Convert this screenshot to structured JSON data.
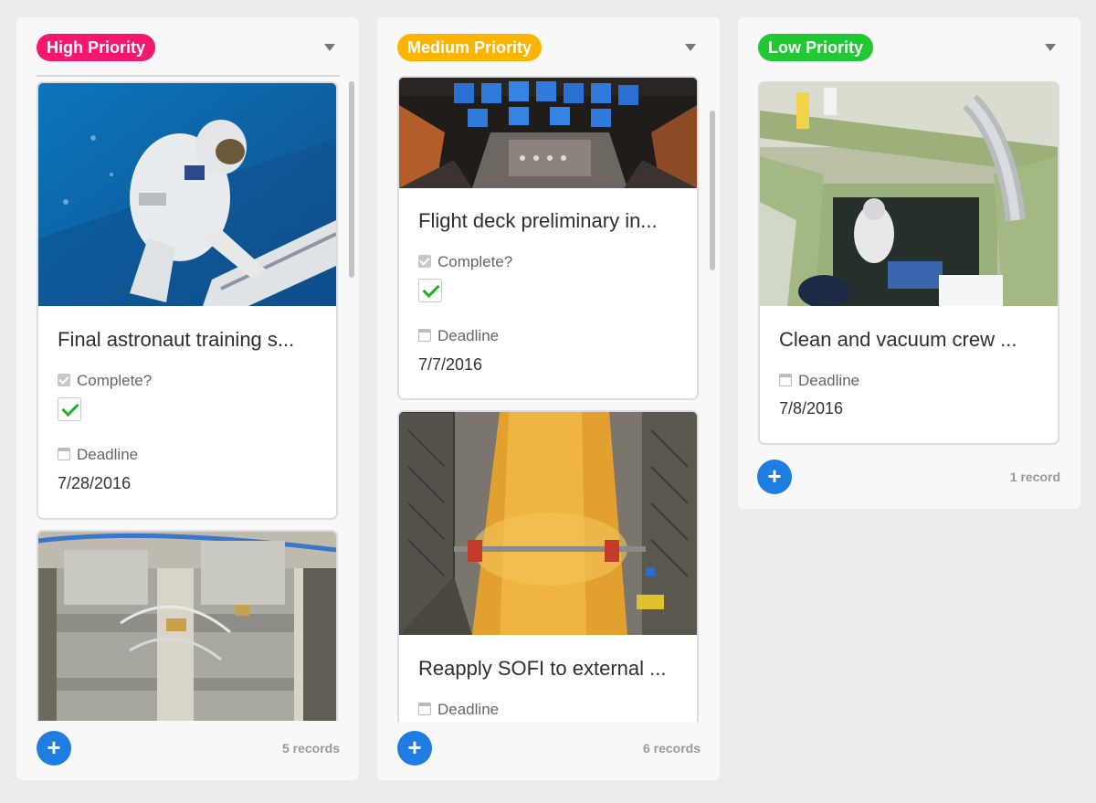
{
  "stacks": [
    {
      "name": "High Priority",
      "color": "#f7186d",
      "record_count": "5 records",
      "cards": [
        {
          "title": "Final astronaut training s...",
          "image": "astronaut-underwater-training-photo",
          "complete_label": "Complete?",
          "complete": true,
          "deadline_label": "Deadline",
          "deadline": "7/28/2016"
        },
        {
          "image": "space-station-hardware-photo"
        }
      ]
    },
    {
      "name": "Medium Priority",
      "color": "#fcb400",
      "record_count": "6 records",
      "cards": [
        {
          "title": "Flight deck preliminary in...",
          "image": "shuttle-flight-deck-photo",
          "complete_label": "Complete?",
          "complete": true,
          "deadline_label": "Deadline",
          "deadline": "7/7/2016"
        },
        {
          "title": "Reapply SOFI to external ...",
          "image": "external-tank-hangar-photo",
          "deadline_label": "Deadline"
        }
      ]
    },
    {
      "name": "Low Priority",
      "color": "#20c933",
      "record_count": "1 record",
      "cards": [
        {
          "title": "Clean and vacuum crew ...",
          "image": "crew-module-cleanroom-photo",
          "deadline_label": "Deadline",
          "deadline": "7/8/2016"
        }
      ]
    }
  ],
  "icons": {
    "add": "+",
    "collapse": "chevron-down-icon",
    "checkbox_field": "checkbox-field-icon",
    "date_field": "calendar-field-icon"
  }
}
